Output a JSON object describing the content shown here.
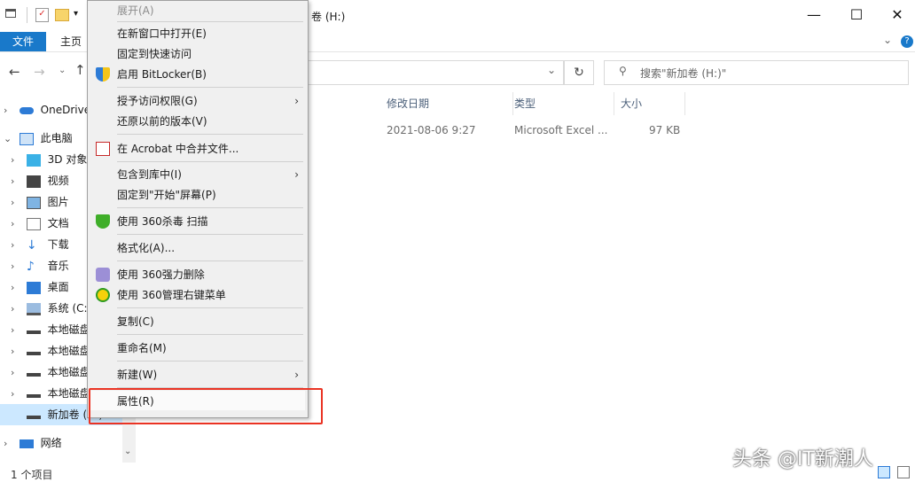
{
  "ribbon": {
    "file_tab": "文件",
    "home_tab": "主页"
  },
  "title": {
    "text": "卷 (H:)"
  },
  "window_buttons": {
    "minimize": "—",
    "maximize": "☐",
    "close": "✕"
  },
  "search": {
    "placeholder": "搜索\"新加卷 (H:)\""
  },
  "nav": {
    "items": [
      {
        "label": "OneDrive",
        "icon": "onedrive-icon"
      },
      {
        "label": "此电脑",
        "icon": "computer-icon"
      },
      {
        "label": "3D 对象",
        "icon": "3d-objects-icon"
      },
      {
        "label": "视频",
        "icon": "video-icon"
      },
      {
        "label": "图片",
        "icon": "pictures-icon"
      },
      {
        "label": "文档",
        "icon": "documents-icon"
      },
      {
        "label": "下载",
        "icon": "download-icon"
      },
      {
        "label": "音乐",
        "icon": "music-icon"
      },
      {
        "label": "桌面",
        "icon": "desktop-icon"
      },
      {
        "label": "系统 (C:)",
        "icon": "system-drive-icon"
      },
      {
        "label": "本地磁盘",
        "icon": "drive-icon"
      },
      {
        "label": "本地磁盘",
        "icon": "drive-icon"
      },
      {
        "label": "本地磁盘",
        "icon": "drive-icon"
      },
      {
        "label": "本地磁盘",
        "icon": "drive-icon"
      },
      {
        "label": "新加卷 (H:)",
        "icon": "drive-icon"
      },
      {
        "label": "网络",
        "icon": "network-icon"
      }
    ]
  },
  "columns": {
    "modified": "修改日期",
    "type": "类型",
    "size": "大小"
  },
  "file_row": {
    "modified": "2021-08-06 9:27",
    "type": "Microsoft Excel ...",
    "size": "97 KB"
  },
  "context_menu": {
    "items": [
      {
        "label": "展开(A)",
        "disabled": true
      },
      {
        "label": "在新窗口中打开(E)"
      },
      {
        "label": "固定到快速访问"
      },
      {
        "label": "启用 BitLocker(B)",
        "icon": "shield-icon"
      },
      {
        "label": "授予访问权限(G)",
        "submenu": true
      },
      {
        "label": "还原以前的版本(V)"
      },
      {
        "label": "在 Acrobat 中合并文件...",
        "icon": "acrobat-icon"
      },
      {
        "label": "包含到库中(I)",
        "submenu": true
      },
      {
        "label": "固定到\"开始\"屏幕(P)"
      },
      {
        "label": "使用 360杀毒 扫描",
        "icon": "360-antivirus-icon"
      },
      {
        "label": "格式化(A)..."
      },
      {
        "label": "使用 360强力删除",
        "icon": "360-delete-icon"
      },
      {
        "label": "使用 360管理右键菜单",
        "icon": "360-manage-icon"
      },
      {
        "label": "复制(C)"
      },
      {
        "label": "重命名(M)"
      },
      {
        "label": "新建(W)",
        "submenu": true
      },
      {
        "label": "属性(R)"
      }
    ]
  },
  "status": {
    "count": "1 个项目"
  },
  "watermark": {
    "text": "头条 @IT新潮人"
  },
  "colors": {
    "accent": "#1979ca",
    "highlight_box": "#ea3323",
    "menu_bg": "#f0f0f0"
  }
}
